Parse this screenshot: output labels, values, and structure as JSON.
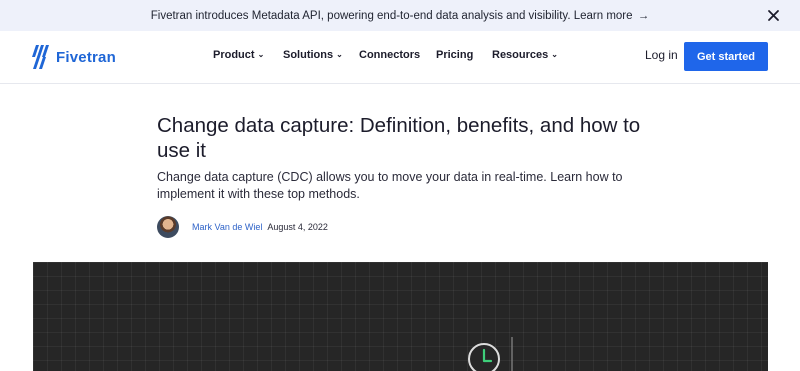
{
  "announcement": {
    "text": "Fivetran introduces Metadata API, powering end-to-end data analysis and visibility. Learn more",
    "arrow": "→"
  },
  "brand": {
    "name": "Fivetran",
    "color": "#1f66d6"
  },
  "nav": {
    "items": [
      {
        "label": "Product",
        "caret": "⌄"
      },
      {
        "label": "Solutions",
        "caret": "⌄"
      },
      {
        "label": "Connectors",
        "caret": ""
      },
      {
        "label": "Pricing",
        "caret": ""
      },
      {
        "label": "Resources",
        "caret": "⌄"
      }
    ],
    "login": "Log in",
    "cta": "Get started",
    "cta_color": "#1f66ea"
  },
  "article": {
    "title": "Change data capture: Definition, benefits, and how to use it",
    "subtitle": "Change data capture (CDC) allows you to move your data in real-time. Learn how to implement it with these top methods.",
    "author": "Mark Van de Wiel",
    "date": "August 4, 2022"
  },
  "hero": {
    "background": "#262626",
    "accent": "#3ecf7a",
    "icon": "clock-icon"
  }
}
